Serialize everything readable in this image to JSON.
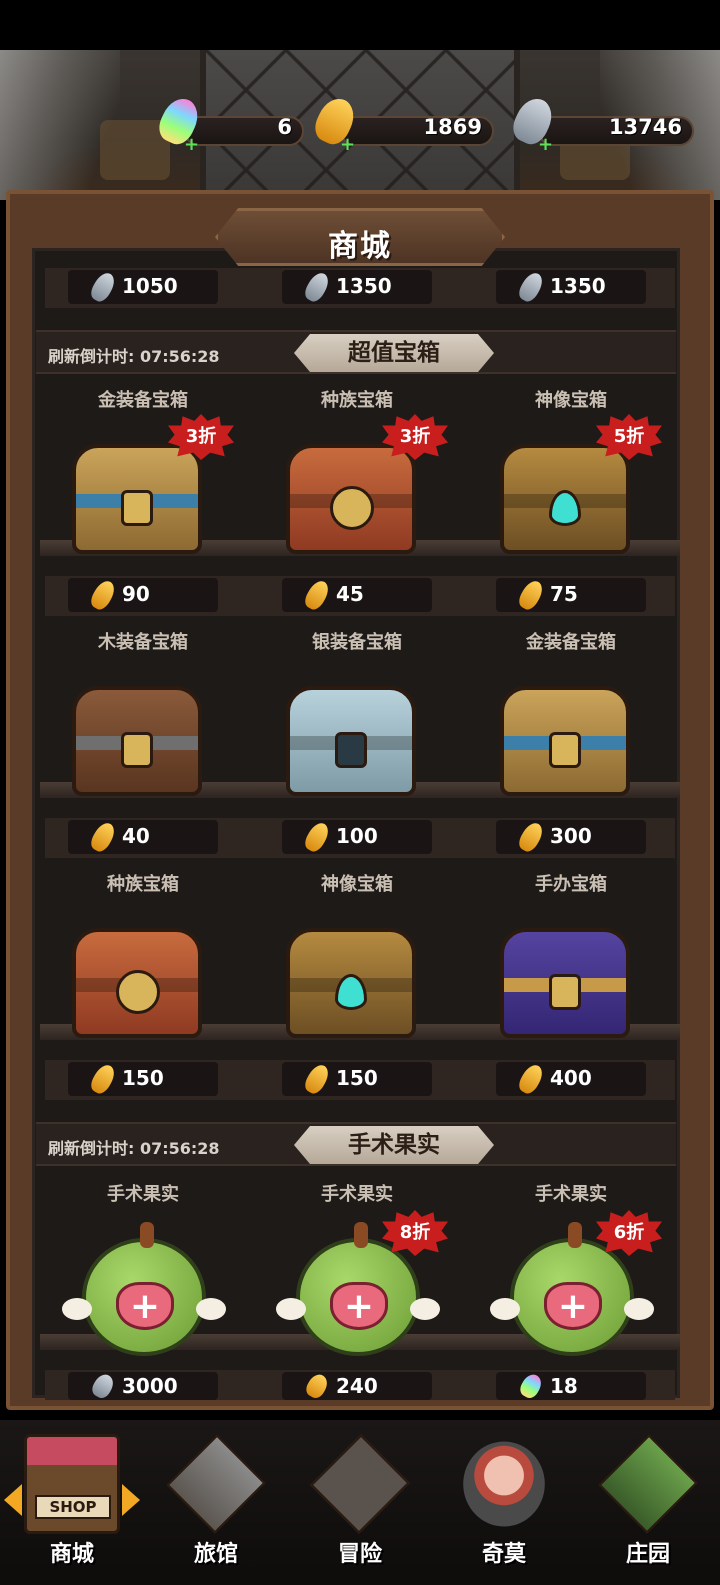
{
  "currencies": [
    {
      "icon": "rainbow-carrot-icon",
      "value": "6"
    },
    {
      "icon": "gold-carrot-icon",
      "value": "1869"
    },
    {
      "icon": "silver-carrot-icon",
      "value": "13746"
    }
  ],
  "shop_title": "商城",
  "top_prices": [
    {
      "icon": "silver-carrot-icon",
      "value": "1050"
    },
    {
      "icon": "silver-carrot-icon",
      "value": "1350"
    },
    {
      "icon": "silver-carrot-icon",
      "value": "1350"
    }
  ],
  "section_chests": {
    "countdown": "刷新倒计时: 07:56:28",
    "name": "超值宝箱",
    "rows": [
      [
        {
          "name": "金装备宝箱",
          "type": "gold",
          "discount": "3折",
          "price": "90",
          "currency": "gold"
        },
        {
          "name": "种族宝箱",
          "type": "race",
          "discount": "3折",
          "price": "45",
          "currency": "gold"
        },
        {
          "name": "神像宝箱",
          "type": "statue",
          "discount": "5折",
          "price": "75",
          "currency": "gold"
        }
      ],
      [
        {
          "name": "木装备宝箱",
          "type": "wood",
          "discount": "",
          "price": "40",
          "currency": "gold"
        },
        {
          "name": "银装备宝箱",
          "type": "silver",
          "discount": "",
          "price": "100",
          "currency": "gold"
        },
        {
          "name": "金装备宝箱",
          "type": "gold",
          "discount": "",
          "price": "300",
          "currency": "gold"
        }
      ],
      [
        {
          "name": "种族宝箱",
          "type": "race",
          "discount": "",
          "price": "150",
          "currency": "gold"
        },
        {
          "name": "神像宝箱",
          "type": "statue",
          "discount": "",
          "price": "150",
          "currency": "gold"
        },
        {
          "name": "手办宝箱",
          "type": "figure",
          "discount": "",
          "price": "400",
          "currency": "gold"
        }
      ]
    ]
  },
  "section_fruit": {
    "countdown": "刷新倒计时: 07:56:28",
    "name": "手术果实",
    "items": [
      {
        "name": "手术果实",
        "discount": "",
        "price": "3000",
        "currency": "silver"
      },
      {
        "name": "手术果实",
        "discount": "8折",
        "price": "240",
        "currency": "gold"
      },
      {
        "name": "手术果实",
        "discount": "6折",
        "price": "18",
        "currency": "rainbow"
      }
    ]
  },
  "nav": [
    {
      "label": "商城",
      "sign": "SHOP",
      "active": true
    },
    {
      "label": "旅馆",
      "active": false
    },
    {
      "label": "冒险",
      "active": false
    },
    {
      "label": "奇莫",
      "active": false
    },
    {
      "label": "庄园",
      "active": false
    }
  ]
}
